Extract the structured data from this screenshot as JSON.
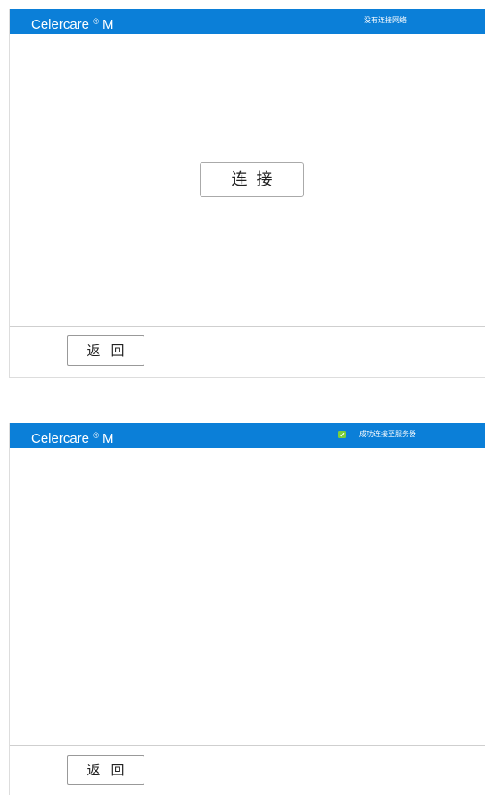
{
  "screens": [
    {
      "app_title": "Celercare",
      "app_title_mark": "®",
      "app_title_suffix": "M",
      "status_text": "没有连接网络",
      "connect_label": "连接",
      "back_label": "返回"
    },
    {
      "app_title": "Celercare",
      "app_title_mark": "®",
      "app_title_suffix": "M",
      "status_icon": "check-icon",
      "status_text": "成功连接至服务器",
      "back_label": "返回"
    }
  ],
  "colors": {
    "titlebar": "#0b7fd8",
    "status_ok": "#7ccf3a"
  }
}
